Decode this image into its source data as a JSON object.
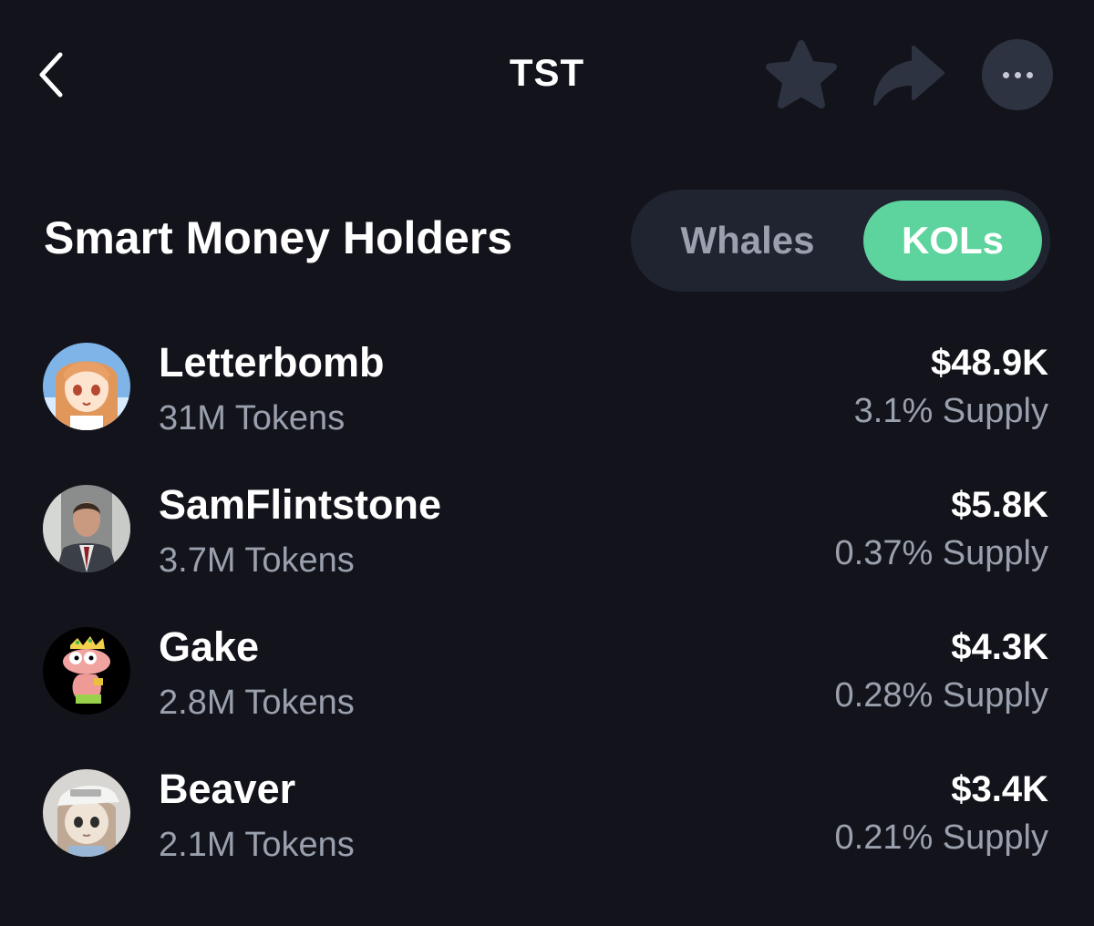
{
  "header": {
    "title": "TST",
    "icons": {
      "back": "chevron-left-icon",
      "star": "star-icon",
      "share": "share-arrow-icon",
      "more": "more-dots-icon"
    }
  },
  "section": {
    "title": "Smart Money Holders",
    "tabs": [
      {
        "label": "Whales",
        "selected": false
      },
      {
        "label": "KOLs",
        "selected": true
      }
    ]
  },
  "holders": [
    {
      "name": "Letterbomb",
      "tokens": "31M Tokens",
      "value": "$48.9K",
      "supply": "3.1% Supply"
    },
    {
      "name": "SamFlintstone",
      "tokens": "3.7M Tokens",
      "value": "$5.8K",
      "supply": "0.37% Supply"
    },
    {
      "name": "Gake",
      "tokens": "2.8M Tokens",
      "value": "$4.3K",
      "supply": "0.28% Supply"
    },
    {
      "name": "Beaver",
      "tokens": "2.1M Tokens",
      "value": "$3.4K",
      "supply": "0.21% Supply"
    }
  ],
  "colors": {
    "background": "#13141b",
    "accent": "#5dd39e",
    "muted_text": "#9aa0ad",
    "pill_background": "#1f2430",
    "icon_dim": "#2e3341"
  }
}
